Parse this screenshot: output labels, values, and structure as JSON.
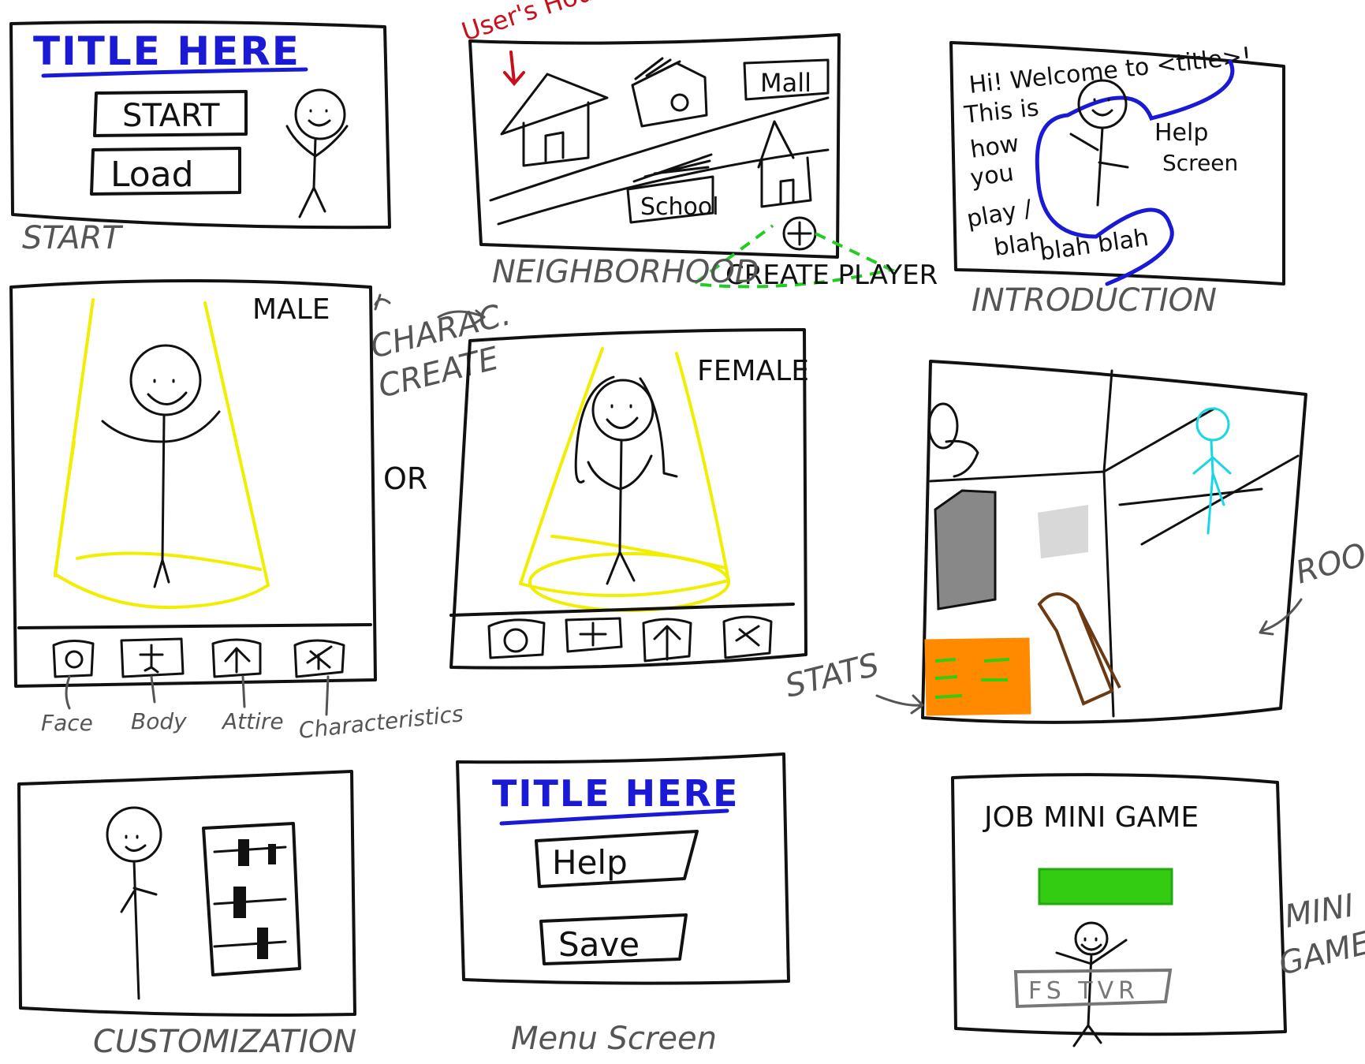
{
  "colors": {
    "ink": "#111111",
    "caption": "#555555",
    "title_blue": "#1a1ad6",
    "annotation_red": "#c8101c",
    "highlight_yellow": "#f2ee00",
    "guide_green": "#22cc22",
    "npc_cyan": "#18d6e6",
    "stats_orange": "#ff8a00",
    "bed_brown": "#6b3a12",
    "furniture_gray": "#888888",
    "meter_green": "#33cc11"
  },
  "start": {
    "title": "TITLE HERE",
    "start_button": "START",
    "load_button": "Load",
    "caption": "START"
  },
  "neighborhood": {
    "annotation": "User's House",
    "mall_label": "Mall",
    "school_label": "School",
    "create_player": "CREATE PLAYER",
    "caption": "NEIGHBORHOOD"
  },
  "introduction": {
    "speech": [
      "Hi! Welcome to <title>!",
      "This is",
      "how",
      "you",
      "play /",
      "blah",
      "blah blah"
    ],
    "side_note": [
      "Help",
      "Screen"
    ],
    "caption": "INTRODUCTION"
  },
  "character_create": {
    "male_label": "MALE",
    "female_label": "FEMALE",
    "side_label": [
      "CHARAC.",
      "CREATE"
    ],
    "or_label": "OR",
    "tab_labels": [
      "Face",
      "Body",
      "Attire",
      "Characteristics"
    ],
    "tab_icons": [
      "face-icon",
      "body-icon",
      "attire-icon",
      "characteristics-icon"
    ]
  },
  "room": {
    "caption": "ROOM",
    "stats_label": "STATS"
  },
  "customization": {
    "caption": "CUSTOMIZATION"
  },
  "menu": {
    "title": "TITLE HERE",
    "help_button": "Help",
    "save_button": "Save",
    "caption": "Menu Screen"
  },
  "minigame": {
    "title": "JOB MINI GAME",
    "keys": "FS TVR",
    "caption": [
      "MINI",
      "GAME"
    ]
  }
}
